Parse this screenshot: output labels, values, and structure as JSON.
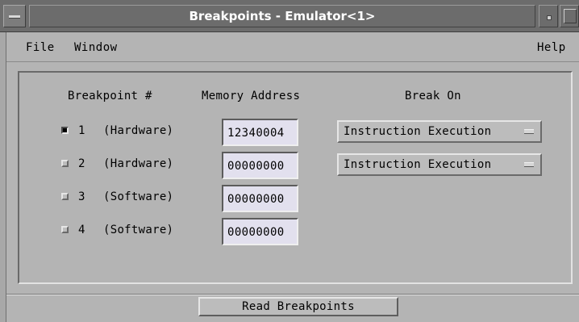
{
  "window": {
    "title": "Breakpoints - Emulator<1>"
  },
  "menubar": {
    "file": "File",
    "window": "Window",
    "help": "Help"
  },
  "headers": {
    "breakpoint": "Breakpoint #",
    "address": "Memory Address",
    "break_on": "Break On"
  },
  "rows": [
    {
      "number": "1",
      "type": "(Hardware)",
      "enabled": true,
      "address": "12340004",
      "break_on": "Instruction Execution"
    },
    {
      "number": "2",
      "type": "(Hardware)",
      "enabled": false,
      "address": "00000000",
      "break_on": "Instruction Execution"
    },
    {
      "number": "3",
      "type": "(Software)",
      "enabled": false,
      "address": "00000000"
    },
    {
      "number": "4",
      "type": "(Software)",
      "enabled": false,
      "address": "00000000"
    }
  ],
  "actions": {
    "read_breakpoints": "Read Breakpoints"
  }
}
